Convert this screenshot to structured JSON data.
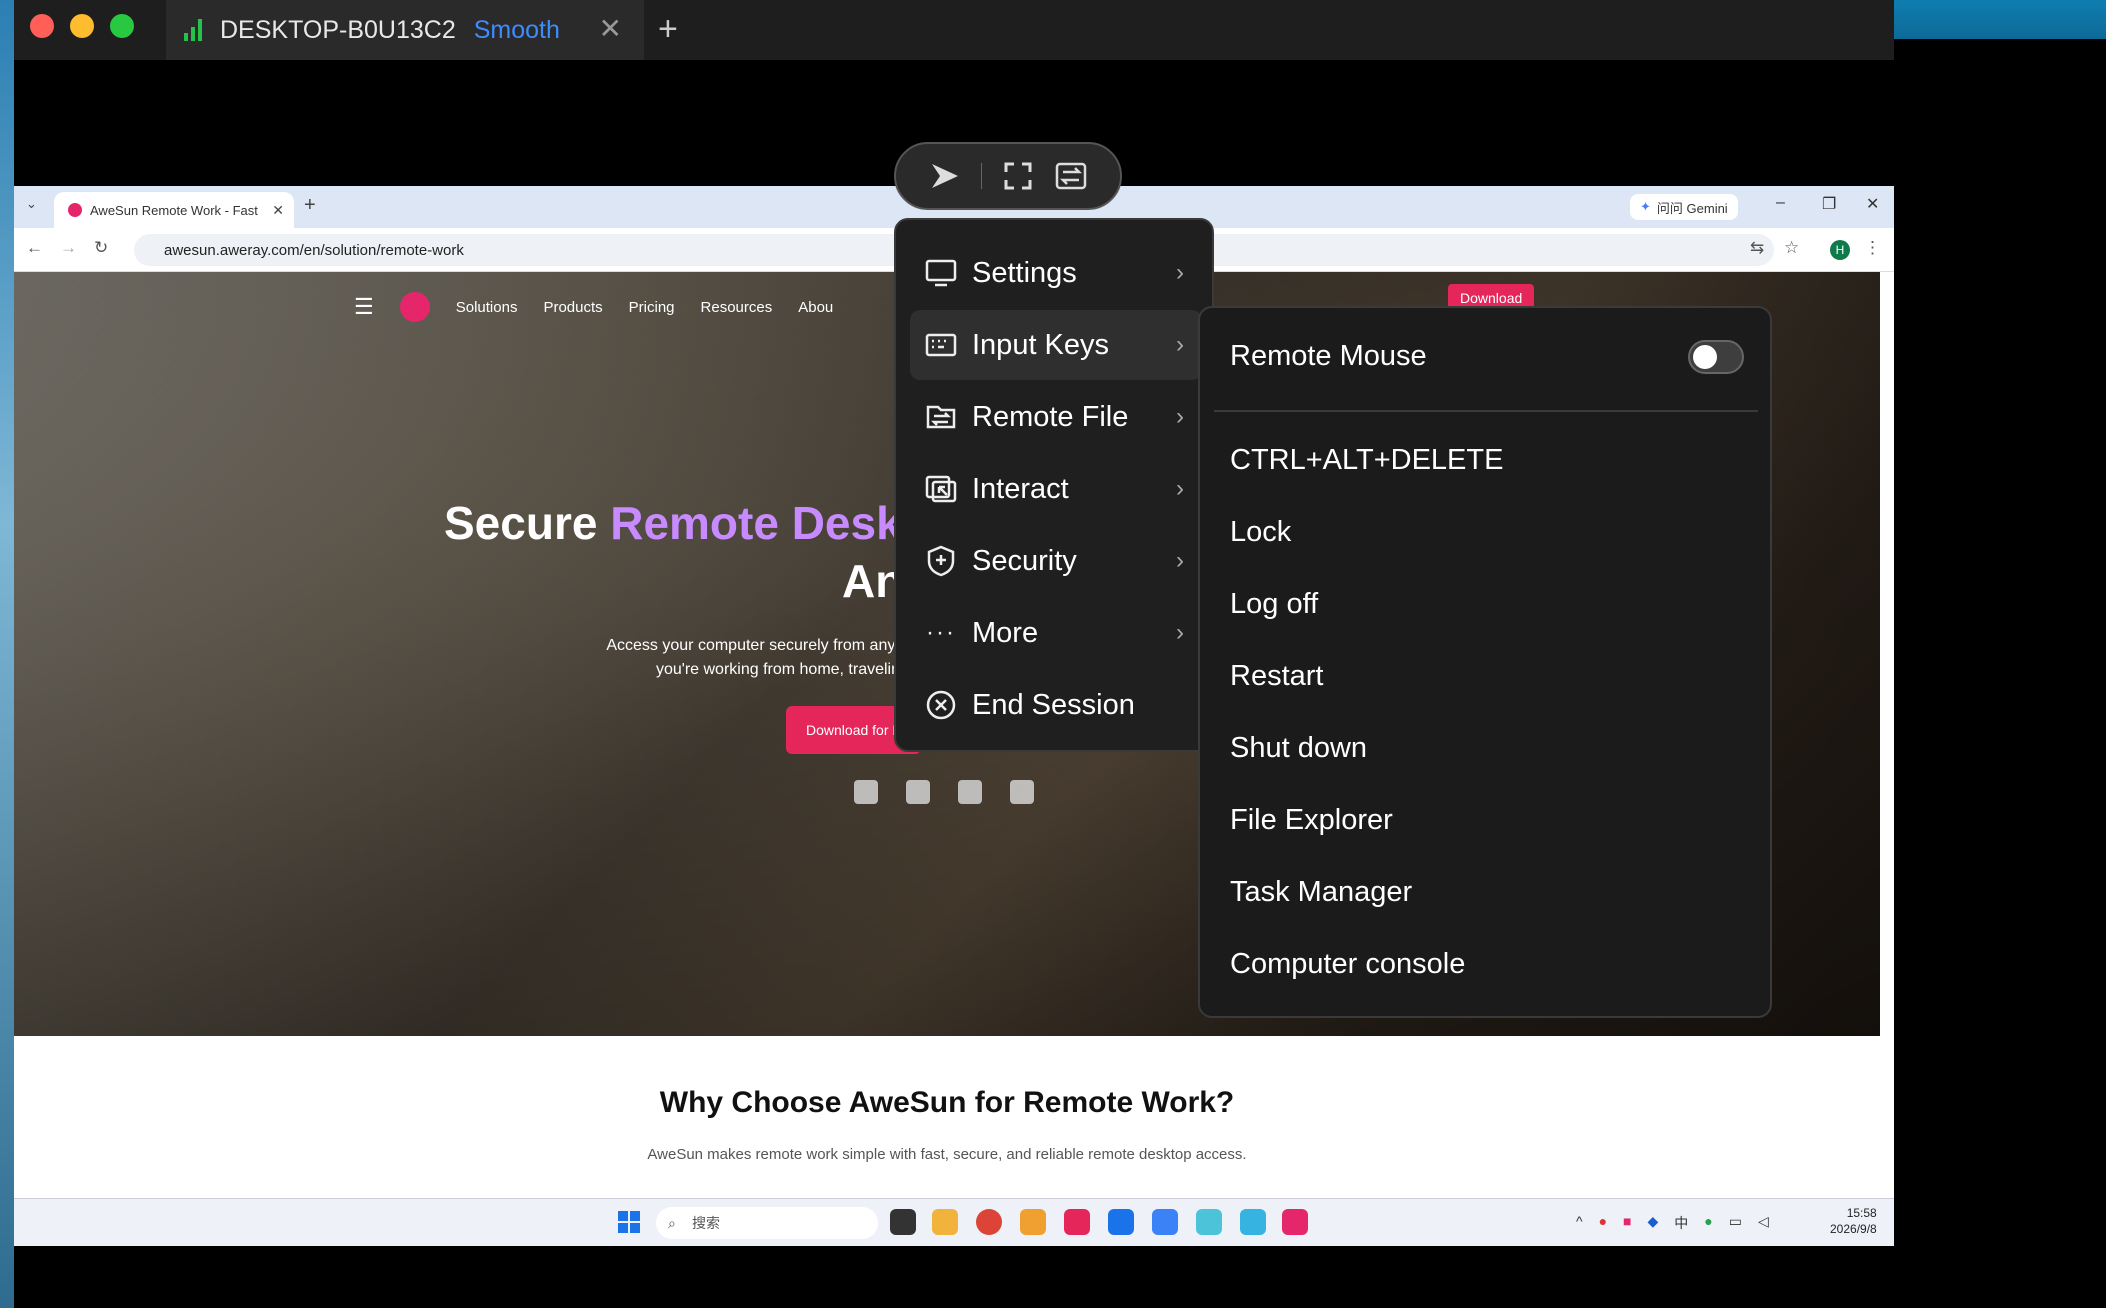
{
  "client": {
    "session_host": "DESKTOP-B0U13C2",
    "session_quality": "Smooth",
    "tab_close": "✕",
    "tab_add": "+"
  },
  "browser": {
    "tab_title": "AweSun Remote Work - Fast",
    "gemini_label": "问问 Gemini",
    "url": "awesun.aweray.com/en/solution/remote-work",
    "profile_initial": "H"
  },
  "site": {
    "nav": [
      "Solutions",
      "Products",
      "Pricing",
      "Resources",
      "Abou"
    ],
    "download_button": "Download",
    "hero_title_plain": "Secure ",
    "hero_title_accent": "Remote Desk",
    "hero_title_line2": "An",
    "hero_sub_line1": "Access your computer securely from anywhere with fa",
    "hero_sub_line2": "you're working from home, traveling for l",
    "hero_cta": "Download for F",
    "why_title": "Why Choose AweSun for Remote Work?",
    "why_sub": "AweSun makes remote work simple with fast, secure, and reliable remote desktop access."
  },
  "taskbar": {
    "search_placeholder": "搜索",
    "ime": "中",
    "time": "15:58",
    "date": "2026/9/8"
  },
  "menu": {
    "items": [
      {
        "label": "Settings",
        "icon": "monitor-icon",
        "has_sub": true
      },
      {
        "label": "Input Keys",
        "icon": "keyboard-icon",
        "has_sub": true,
        "active": true
      },
      {
        "label": "Remote File",
        "icon": "file-transfer-icon",
        "has_sub": true
      },
      {
        "label": "Interact",
        "icon": "interact-icon",
        "has_sub": true
      },
      {
        "label": "Security",
        "icon": "shield-icon",
        "has_sub": true
      },
      {
        "label": "More",
        "icon": "more-icon",
        "has_sub": true
      },
      {
        "label": "End Session",
        "icon": "close-circle-icon",
        "has_sub": false
      }
    ]
  },
  "submenu": {
    "remote_mouse_label": "Remote Mouse",
    "remote_mouse_enabled": false,
    "items": [
      "CTRL+ALT+DELETE",
      "Lock",
      "Log off",
      "Restart",
      "Shut down",
      "File Explorer",
      "Task Manager",
      "Computer console"
    ]
  },
  "colors": {
    "accent": "#3d8cff",
    "signal": "#25c24b",
    "brand": "#e5265a",
    "menu_bg": "#1f1f1f"
  }
}
